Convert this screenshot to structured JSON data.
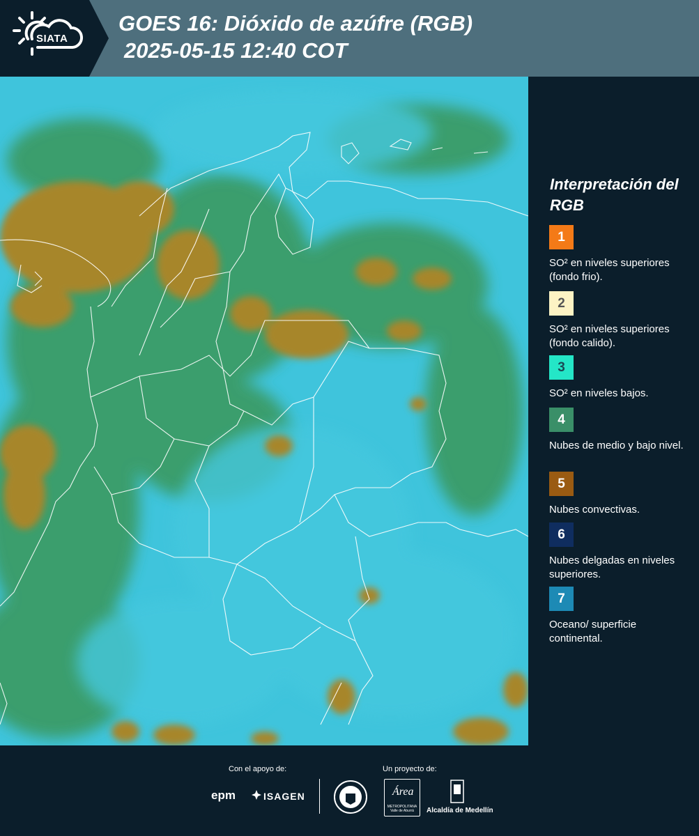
{
  "header": {
    "logo_text": "SIATA",
    "title_line1": "GOES 16: Dióxido de azúfre (RGB)",
    "title_line2": "2025-05-15 12:40 COT"
  },
  "legend": {
    "title": "Interpretación del RGB",
    "items": [
      {
        "number": "1",
        "color": "#f47a17",
        "text_color": "#ffffff",
        "label": "SO² en niveles superiores (fondo frio)."
      },
      {
        "number": "2",
        "color": "#fdf3c4",
        "text_color": "#555555",
        "label": "SO² en niveles superiores (fondo calido)."
      },
      {
        "number": "3",
        "color": "#24e6c7",
        "text_color": "#1a4a55",
        "label": "SO² en niveles bajos."
      },
      {
        "number": "4",
        "color": "#3a8f68",
        "text_color": "#ffffff",
        "label": "Nubes de medio y bajo nivel."
      },
      {
        "number": "5",
        "color": "#9a5b12",
        "text_color": "#ffffff",
        "label": "Nubes convectivas."
      },
      {
        "number": "6",
        "color": "#0f2d5f",
        "text_color": "#ffffff",
        "label": "Nubes delgadas en niveles superiores."
      },
      {
        "number": "7",
        "color": "#1d8ab5",
        "text_color": "#ffffff",
        "label": "Oceano/ superficie continental."
      }
    ]
  },
  "footer": {
    "support_label": "Con el apoyo de:",
    "project_label": "Un proyecto de:",
    "sponsor1": "epm",
    "sponsor2": "ISAGEN",
    "area_logo_text": "Área",
    "area_logo_sub": "METROPOLITANA Valle de Aburrá",
    "alcaldia": "Alcaldía de Medellín"
  },
  "map": {
    "description_colors": {
      "ocean": "#3fc4dc",
      "low_clouds": "#3a9a62",
      "convective": "#a7862a"
    }
  }
}
